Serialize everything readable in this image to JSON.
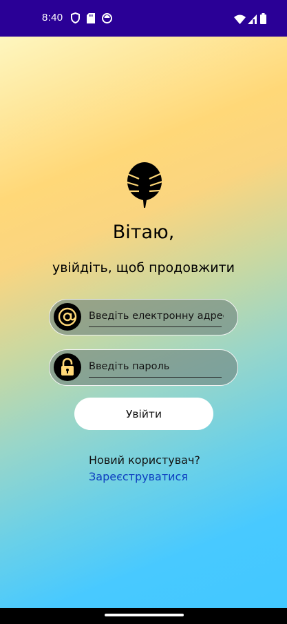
{
  "status_bar": {
    "time": "8:40",
    "left_icons": [
      "shield-icon",
      "sd-card-icon",
      "notification-app-icon"
    ],
    "right_icons": [
      "wifi-icon",
      "cell-signal-icon",
      "battery-icon"
    ],
    "background": "#2a0096"
  },
  "logo": {
    "icon": "monstera-leaf-icon"
  },
  "greeting": {
    "title": "Вітаю,",
    "subtitle": "увійдіть, щоб продовжити"
  },
  "form": {
    "email": {
      "placeholder": "Введіть електронну адресу",
      "value": "",
      "icon": "at-sign-icon"
    },
    "password": {
      "placeholder": "Введіть пароль",
      "value": "",
      "icon": "lock-icon"
    },
    "login_label": "Увійти"
  },
  "signup": {
    "prompt": "Новий користувач?",
    "link_label": "Зареєструватися",
    "link_color": "#0d3ec0"
  },
  "theme": {
    "gradient_top": "#fef6bf",
    "gradient_mid": "#ffd878",
    "gradient_bottom": "#42c8ff"
  }
}
